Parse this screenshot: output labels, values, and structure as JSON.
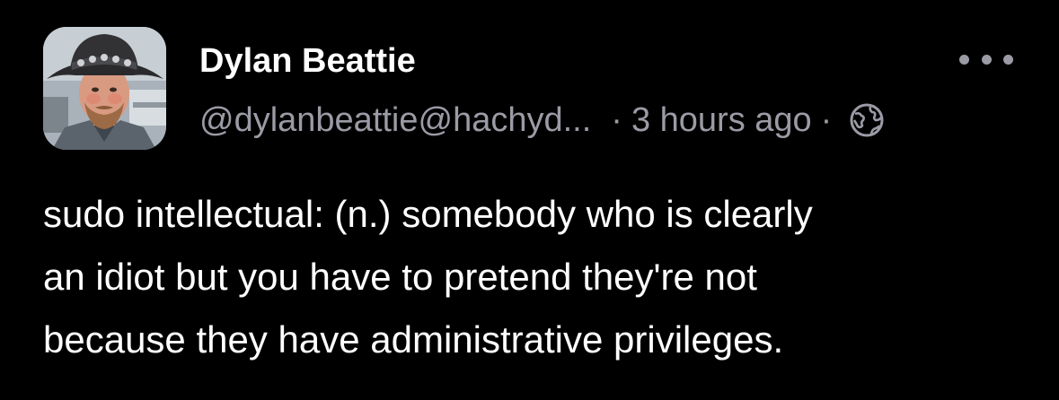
{
  "post": {
    "author": {
      "display_name": "Dylan Beattie",
      "handle": "@dylanbeattie@hachyd...",
      "avatar_icon": "profile-photo"
    },
    "timestamp": "3 hours ago",
    "separator": "·",
    "visibility_icon": "globe-icon",
    "more_icon": "ellipsis-icon",
    "content_lines": [
      "sudo intellectual: (n.) somebody who is clearly",
      "an idiot but you have to pretend they're not",
      "because they have administrative privileges."
    ]
  },
  "colors": {
    "background": "#000000",
    "text": "#ffffff",
    "muted": "#9b9ba6"
  }
}
